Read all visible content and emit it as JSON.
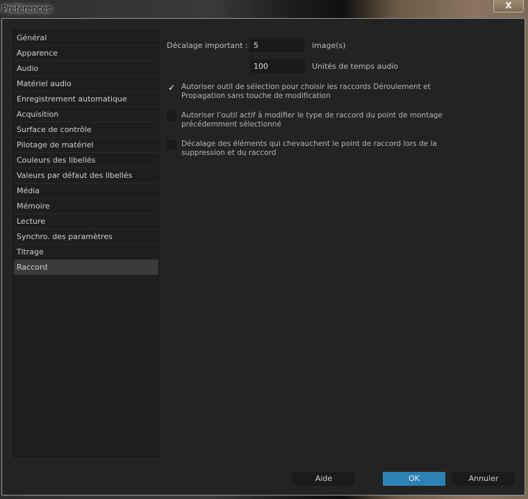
{
  "window": {
    "title": "Préférences",
    "close_label": "X"
  },
  "sidebar": {
    "items": [
      "Général",
      "Apparence",
      "Audio",
      "Matériel audio",
      "Enregistrement automatique",
      "Acquisition",
      "Surface de contrôle",
      "Pilotage de matériel",
      "Couleurs des libellés",
      "Valeurs par défaut des libellés",
      "Média",
      "Mémoire",
      "Lecture",
      "Synchro. des paramètres",
      "Titrage",
      "Raccord"
    ],
    "selected": "Raccord"
  },
  "main": {
    "offset_label": "Décalage important :",
    "frames_value": "5",
    "frames_unit": "image(s)",
    "audio_value": "100",
    "audio_unit": "Unités de temps audio",
    "options": [
      {
        "label": "Autoriser outil de sélection pour choisir les raccords Déroulement et Propagation sans touche de modification",
        "checked": true
      },
      {
        "label": "Autoriser l’outil actif à modifier le type de raccord du point de montage précédemment sélectionné",
        "checked": false
      },
      {
        "label": "Décalage des éléments qui chevauchent le point de raccord lors de la suppression et du raccord",
        "checked": false
      }
    ]
  },
  "buttons": {
    "help": "Aide",
    "ok": "OK",
    "cancel": "Annuler"
  },
  "colors": {
    "accent": "#2d82b5"
  }
}
